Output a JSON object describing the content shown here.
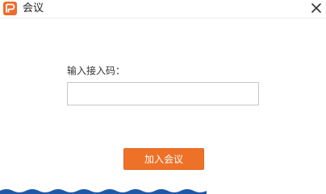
{
  "window": {
    "title": "会议"
  },
  "form": {
    "label": "输入接入码：",
    "code_value": "",
    "code_placeholder": ""
  },
  "actions": {
    "join_label": "加入会议"
  },
  "colors": {
    "accent": "#ed7127",
    "logo": "#ee6b2b",
    "bottom_band": "#1d57a8"
  },
  "icons": {
    "app": "app-logo-icon",
    "close": "close-icon"
  }
}
